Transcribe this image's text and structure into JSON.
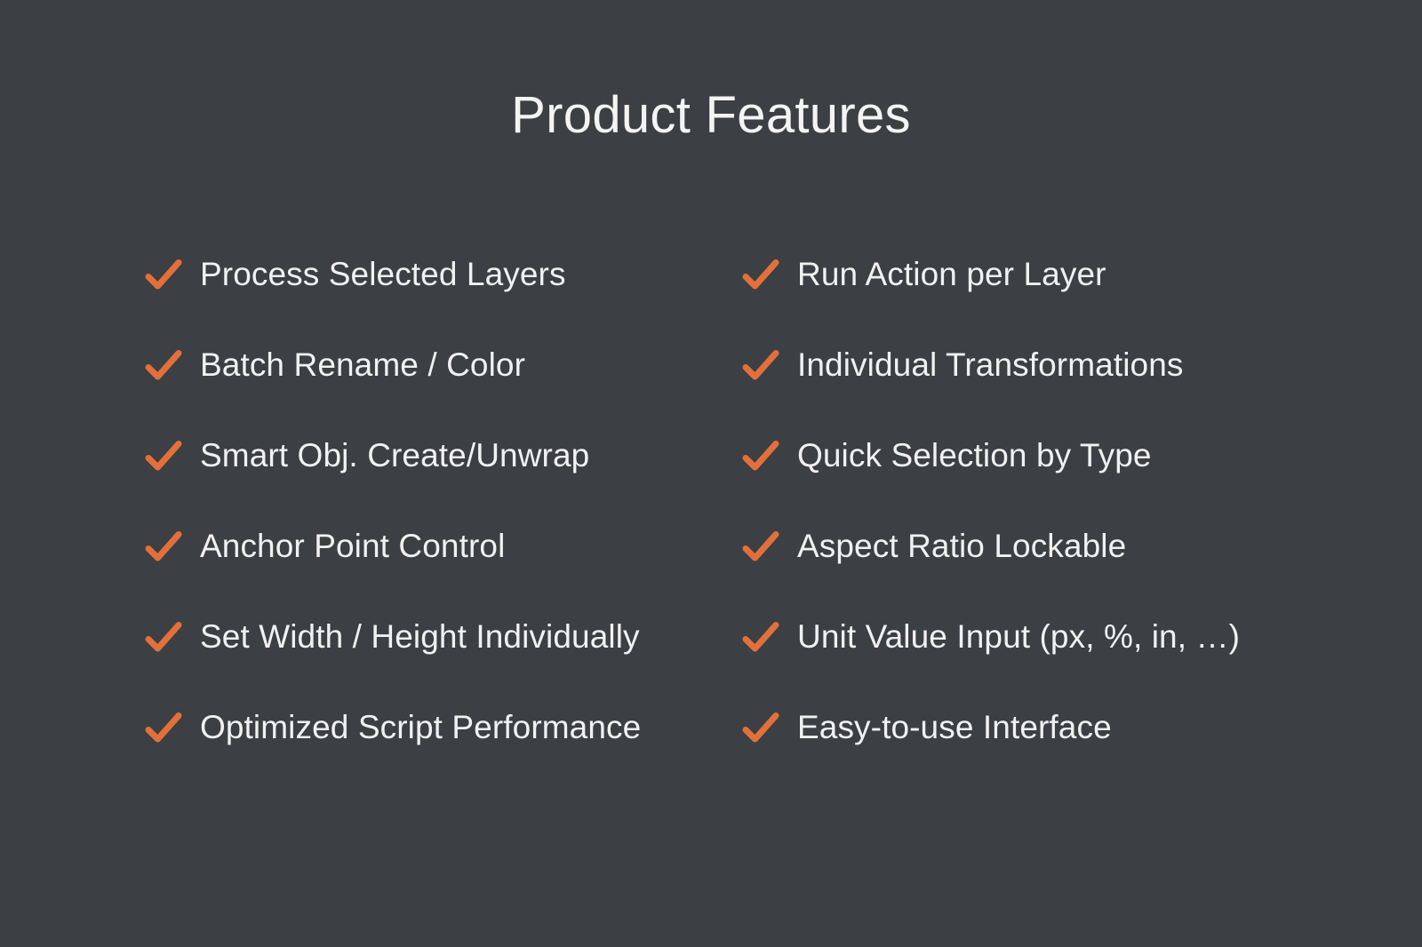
{
  "slide": {
    "title": "Product Features",
    "background_color": "#3C3F43",
    "title_color": "#F4F4F4",
    "text_color": "#F1F1F1",
    "accent_color": "#E2703A",
    "check_icon_name": "check-icon"
  },
  "columns": [
    {
      "name": "left",
      "items": [
        {
          "label": "Process Selected Layers"
        },
        {
          "label": "Batch Rename / Color"
        },
        {
          "label": "Smart Obj. Create/Unwrap"
        },
        {
          "label": "Anchor Point Control"
        },
        {
          "label": "Set Width / Height Individually"
        },
        {
          "label": "Optimized Script Performance"
        }
      ]
    },
    {
      "name": "right",
      "items": [
        {
          "label": "Run Action per Layer"
        },
        {
          "label": "Individual Transformations"
        },
        {
          "label": "Quick Selection by Type"
        },
        {
          "label": "Aspect Ratio Lockable"
        },
        {
          "label": "Unit Value Input (px, %, in, …)"
        },
        {
          "label": "Easy-to-use Interface"
        }
      ]
    }
  ]
}
